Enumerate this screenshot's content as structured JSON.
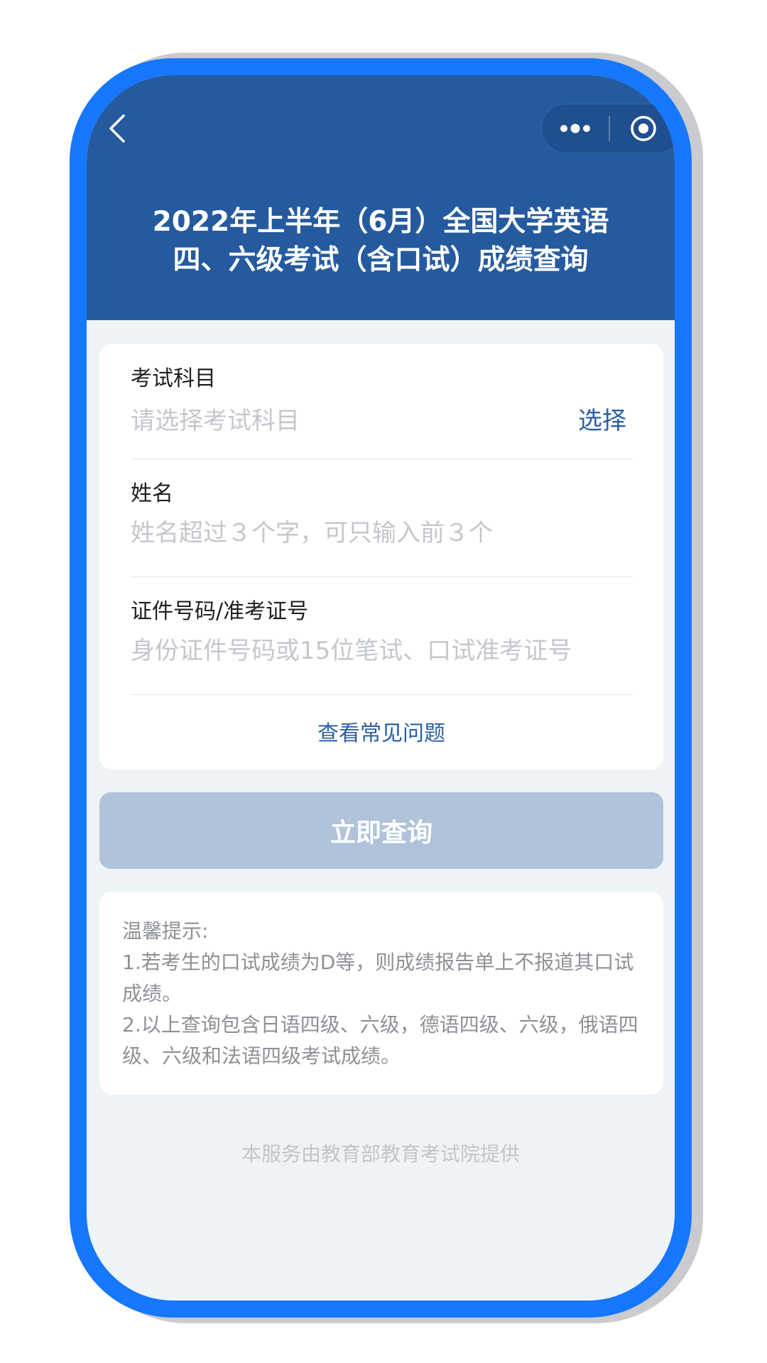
{
  "header": {
    "title_line1": "2022年上半年（6月）全国大学英语",
    "title_line2": "四、六级考试（含口试）成绩查询",
    "back_icon": "chevron-left-icon",
    "more_icon": "more-dots-icon",
    "close_icon": "target-circle-icon",
    "background_color": "#255a9f"
  },
  "form": {
    "subject": {
      "label": "考试科目",
      "placeholder": "请选择考试科目",
      "action_label": "选择"
    },
    "name": {
      "label": "姓名",
      "placeholder": "姓名超过３个字，可只输入前３个"
    },
    "id_number": {
      "label": "证件号码/准考证号",
      "placeholder": "身份证件号码或15位笔试、口试准考证号"
    },
    "faq_label": "查看常见问题"
  },
  "query_button": {
    "label": "立即查询",
    "color": "#b0c3db"
  },
  "tips": {
    "title": "温馨提示:",
    "line1": "1.若考生的口试成绩为D等，则成绩报告单上不报道其口试成绩。",
    "line2": "2.以上查询包含日语四级、六级，德语四级、六级，俄语四级、六级和法语四级考试成绩。"
  },
  "footer": {
    "text": "本服务由教育部教育考试院提供"
  },
  "colors": {
    "frame": "#1677ff",
    "accent": "#2a5fa5",
    "page_background": "#eef3f6"
  }
}
